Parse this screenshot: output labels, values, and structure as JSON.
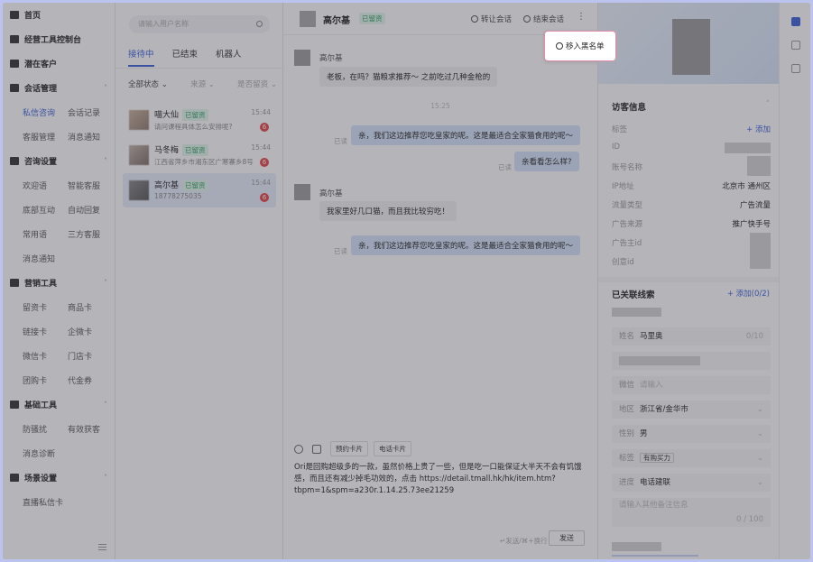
{
  "sidebar": {
    "groups": [
      {
        "label": "首页",
        "icon": "home-icon",
        "rows": []
      },
      {
        "label": "经营工具控制台",
        "icon": "dashboard-icon",
        "rows": []
      },
      {
        "label": "潜在客户",
        "icon": "users-icon",
        "rows": []
      },
      {
        "label": "会话管理",
        "icon": "flag-icon",
        "chevron": "˄",
        "rows": [
          [
            "私信咨询",
            "会话记录"
          ],
          [
            "客服管理",
            "消息通知"
          ]
        ]
      },
      {
        "label": "咨询设置",
        "icon": "user-gear-icon",
        "chevron": "˄",
        "rows": [
          [
            "欢迎语",
            "智能客服"
          ],
          [
            "底部互动",
            "自动回复"
          ],
          [
            "常用语",
            "三方客服"
          ],
          [
            "消息通知",
            ""
          ]
        ]
      },
      {
        "label": "营销工具",
        "icon": "folder-icon",
        "chevron": "˄",
        "rows": [
          [
            "留资卡",
            "商品卡"
          ],
          [
            "链接卡",
            "企微卡"
          ],
          [
            "微信卡",
            "门店卡"
          ],
          [
            "团购卡",
            "代金券"
          ]
        ]
      },
      {
        "label": "基础工具",
        "icon": "toolbox-icon",
        "chevron": "˄",
        "rows": [
          [
            "防骚扰",
            "有效获客"
          ],
          [
            "消息诊断",
            ""
          ]
        ]
      },
      {
        "label": "场景设置",
        "icon": "settings-icon",
        "chevron": "˄",
        "rows": [
          [
            "直播私信卡",
            ""
          ]
        ]
      }
    ],
    "active_item": "私信咨询"
  },
  "conv_list": {
    "search_placeholder": "请输入用户名称",
    "tabs": [
      "接待中",
      "已结束",
      "机器人"
    ],
    "filters": [
      "全部状态 ⌄",
      "来源 ⌄",
      "是否留资 ⌄"
    ],
    "items": [
      {
        "name": "喵大仙",
        "badge": "已留资",
        "msg": "请问课程具体怎么安排呢?",
        "time": "15:44",
        "count": "6"
      },
      {
        "name": "马冬梅",
        "badge": "已留资",
        "msg": "江西省萍乡市湘东区广寒寨乡8号",
        "time": "15:44",
        "count": "6"
      },
      {
        "name": "高尔基",
        "badge": "已留资",
        "msg": "18778275035",
        "time": "15:44",
        "count": "6"
      }
    ]
  },
  "chat": {
    "title": "高尔基",
    "badge": "已留资",
    "transfer_label": "转让会话",
    "end_label": "结束会话",
    "more_label": "⋮",
    "popup_label": "移入黑名单",
    "messages": {
      "sender1": "高尔基",
      "m1": "老板，在吗？猫粮求推荐～ 之前吃过几种金枪的",
      "time": "15:25",
      "m2": "亲，我们这边推荐您吃皇家的呢。这是最适合全家猫食用的呢～",
      "read1": "已读",
      "m3": "亲看看怎么样?",
      "read2": "已读",
      "sender2": "高尔基",
      "m4": "我家里好几口猫，而且我比较穷吃！",
      "m5": "亲，我们这边推荐您吃皇家的呢。这是最适合全家猫食用的呢～",
      "read3": "已读"
    },
    "tools": {
      "card1": "预约卡片",
      "card2": "电话卡片"
    },
    "input_text": "Ori是回购超级多的一款，虽然价格上贵了一些，但是吃一口能保证大半天不会有饥饿感，而且还有减少掉毛功效的，点击 https://detail.tmall.hk/hk/item.htm?tbpm=1&spm=a230r.1.14.25.73ee21259",
    "hint": "↵发送/⌘+换行",
    "send_label": "发送"
  },
  "info": {
    "visitor_title": "访客信息",
    "visitor_chev": "˄",
    "tag_label": "标签",
    "add_label": "+ 添加",
    "fields": [
      {
        "k": "ID",
        "v": ""
      },
      {
        "k": "账号名称",
        "v": ""
      },
      {
        "k": "IP地址",
        "v": "北京市 通州区"
      },
      {
        "k": "流量类型",
        "v": "广告流量"
      },
      {
        "k": "广告来源",
        "v": "推广快手号"
      },
      {
        "k": "广告主id",
        "v": ""
      },
      {
        "k": "创意id",
        "v": ""
      }
    ],
    "leads_title": "已关联线索",
    "leads_add": "+ 添加(0/2)",
    "form": {
      "name_k": "姓名",
      "name_v": "马里奥",
      "name_count": "0/10",
      "wechat_k": "微信",
      "wechat_p": "请输入",
      "region_k": "地区",
      "region_v": "浙江省/金华市",
      "gender_k": "性别",
      "gender_v": "男",
      "tag_k": "标签",
      "tag_v": "有购买力",
      "progress_k": "进度",
      "progress_v": "电话建联",
      "note_p": "请输入其他备注信息",
      "note_count": "0 / 100"
    }
  }
}
